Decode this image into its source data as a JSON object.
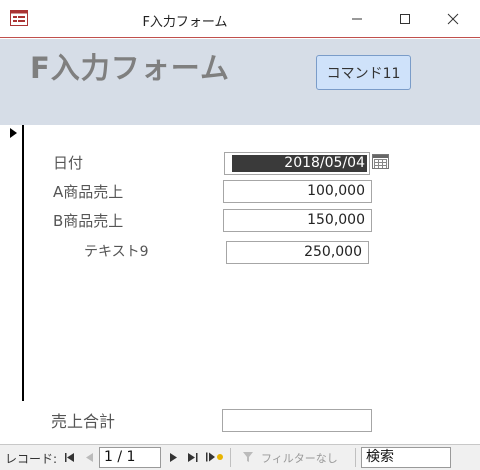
{
  "window": {
    "title": "F入力フォーム",
    "minimize_glyph": "—",
    "maximize_glyph": "☐",
    "close_glyph": "✕"
  },
  "header": {
    "heading": "F入力フォーム",
    "command_button": "コマンド11"
  },
  "detail": {
    "date_label": "日付",
    "date_value": "2018/05/04",
    "a_sales_label": "A商品売上",
    "a_sales_value": "100,000",
    "b_sales_label": "B商品売上",
    "b_sales_value": "150,000",
    "text9_label": "テキスト9",
    "text9_value": "250,000"
  },
  "footer": {
    "total_label": "売上合計",
    "total_value": ""
  },
  "navbar": {
    "record_label": "レコード:",
    "first": "⏮",
    "prev": "◀",
    "current": "1 / 1",
    "next": "▶",
    "last": "⏭",
    "new": "▶✱",
    "filter": "フィルターなし",
    "search": "検索"
  },
  "colors": {
    "header_bg": "#d6dde7",
    "command_button_bg": "#cfe2fa",
    "title_border": "#c0504d",
    "date_selection_bg": "#3a3a3a"
  }
}
